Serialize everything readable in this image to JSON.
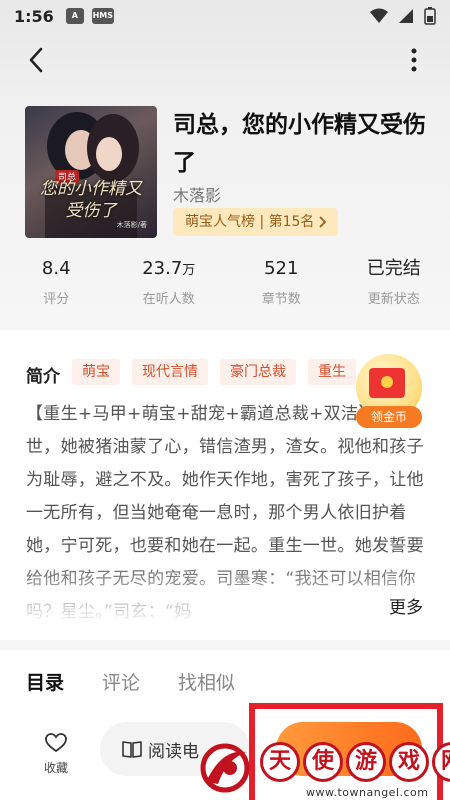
{
  "status_bar": {
    "time": "1:56",
    "icons": [
      "a-app-icon",
      "hms-icon"
    ],
    "right_icons": [
      "wifi-icon",
      "signal-icon",
      "battery-icon"
    ]
  },
  "book": {
    "title": "司总，您的小作精又受伤了",
    "author": "木落影",
    "rank": "萌宝人气榜 | 第15名",
    "cover": {
      "tag": "司总",
      "title": "您的小作精又受伤了",
      "author": "木落影/著"
    }
  },
  "stats": [
    {
      "value": "8.4",
      "unit": "",
      "label": "评分"
    },
    {
      "value": "23.7",
      "unit": "万",
      "label": "在听人数"
    },
    {
      "value": "521",
      "unit": "",
      "label": "章节数"
    },
    {
      "value": "已完结",
      "unit": "",
      "label": "更新状态"
    }
  ],
  "intro": {
    "heading": "简介",
    "tags": [
      "萌宝",
      "现代言情",
      "豪门总裁",
      "重生"
    ],
    "text": "【重生+马甲+萌宝+甜宠+霸道总裁+双洁】上一世，她被猪油蒙了心，错信渣男，渣女。视他和孩子为耻辱，避之不及。她作天作地，害死了孩子，让他一无所有，但当她奄奄一息时，那个男人依旧护着她，宁可死，也要和她在一起。重生一世。她发誓要给他和孩子无尽的宠爱。司墨寒：“我还可以相信你吗？星尘。”司玄：“妈",
    "more": "更多"
  },
  "coin_widget": {
    "label": "领金币"
  },
  "tabs": [
    {
      "label": "目录",
      "active": true
    },
    {
      "label": "评论",
      "active": false
    },
    {
      "label": "找相似",
      "active": false
    }
  ],
  "bottom": {
    "fav_label": "收藏",
    "read_label": "阅读电"
  },
  "watermark": {
    "chars": [
      "天",
      "使",
      "游",
      "戏",
      "网"
    ],
    "url": "www.townangel.com"
  },
  "colors": {
    "accent_orange": "#ff7a22",
    "tag_red": "#d4502f",
    "rank_bg": "#fde9bd",
    "highlight_red": "#e3202b"
  }
}
